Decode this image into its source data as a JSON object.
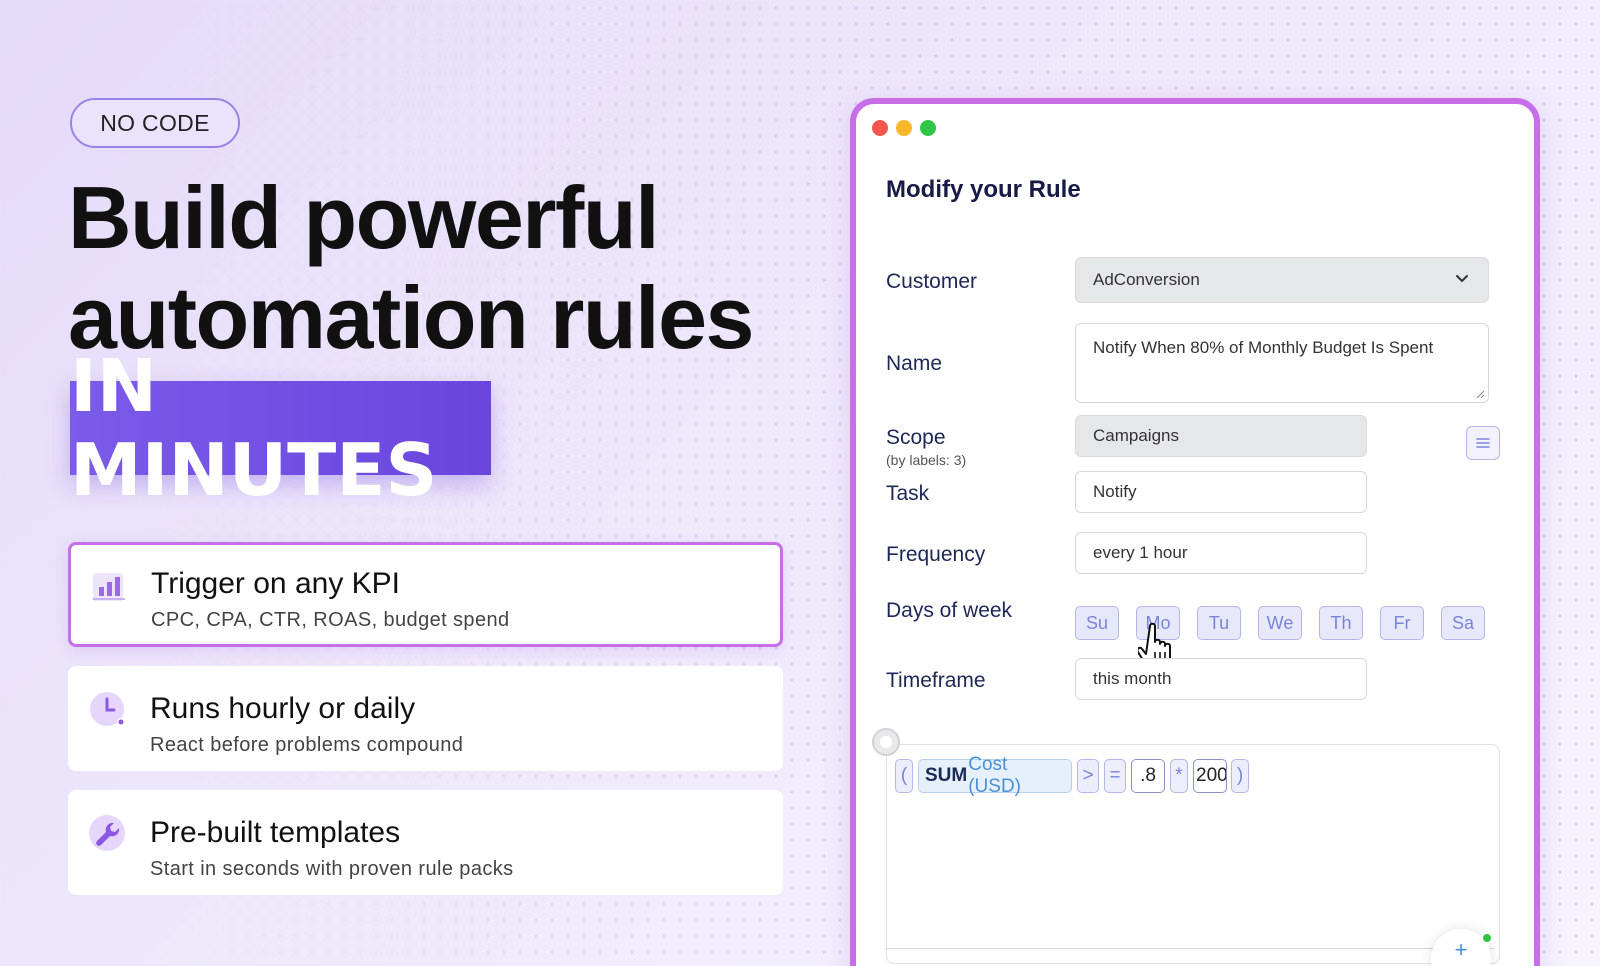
{
  "badge": "NO CODE",
  "headline": {
    "line1": "Build powerful",
    "line2": "automation rules",
    "highlight": "IN MINUTES"
  },
  "features": [
    {
      "title": "Trigger on any KPI",
      "desc": "CPC, CPA, CTR, ROAS, budget spend",
      "icon": "bar-chart-icon"
    },
    {
      "title": "Runs hourly or daily",
      "desc": "React before problems compound",
      "icon": "clock-icon"
    },
    {
      "title": "Pre-built templates",
      "desc": "Start in seconds with proven rule packs",
      "icon": "wrench-icon"
    }
  ],
  "window": {
    "title": "Modify your Rule",
    "customer": {
      "label": "Customer",
      "value": "AdConversion"
    },
    "name": {
      "label": "Name",
      "value": "Notify When 80% of Monthly Budget Is Spent"
    },
    "scope": {
      "label": "Scope",
      "sub": "(by labels: 3)",
      "value": "Campaigns"
    },
    "task": {
      "label": "Task",
      "value": "Notify"
    },
    "frequency": {
      "label": "Frequency",
      "value": "every 1 hour"
    },
    "days": {
      "label": "Days of week",
      "items": [
        "Su",
        "Mo",
        "Tu",
        "We",
        "Th",
        "Fr",
        "Sa"
      ]
    },
    "timeframe": {
      "label": "Timeframe",
      "value": "this month"
    },
    "formula": {
      "open": "(",
      "sum": "SUM",
      "metric": "Cost (USD)",
      "gt": ">",
      "eq": "=",
      "factor": ".8",
      "times": "*",
      "amount": "200",
      "close": ")"
    },
    "fab": "+"
  },
  "colors": {
    "accent": "#6a45de",
    "border": "#c86ee9",
    "day_text": "#7b84d9"
  }
}
